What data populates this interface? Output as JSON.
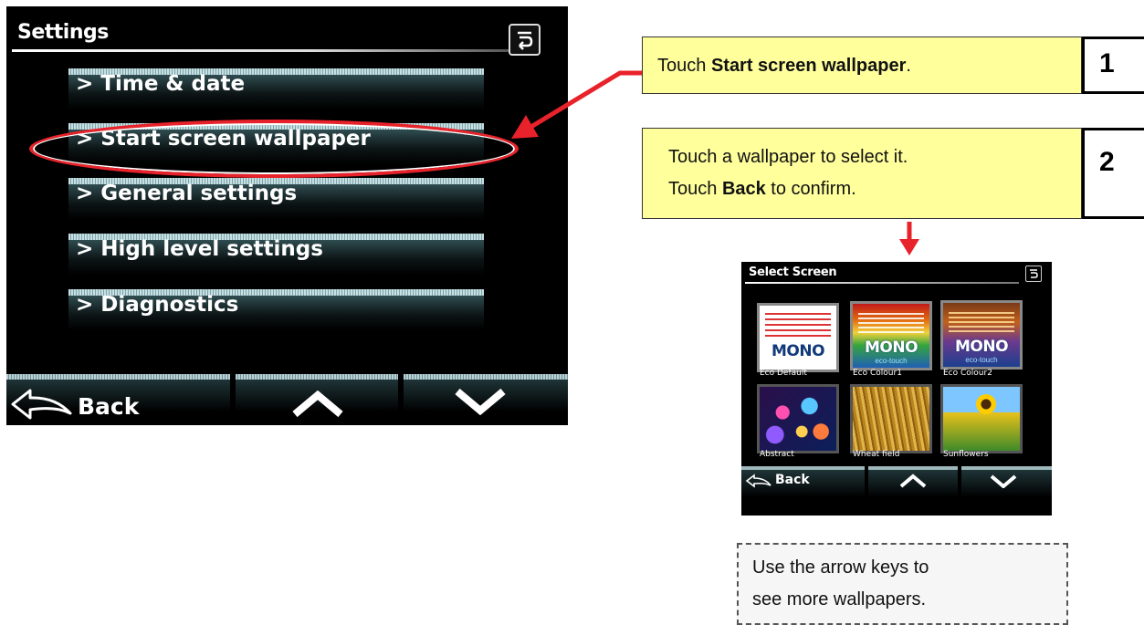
{
  "device": {
    "title": "Settings",
    "menu": [
      {
        "label": "> Time & date"
      },
      {
        "label": "> Start screen wallpaper"
      },
      {
        "label": "> General settings"
      },
      {
        "label": "> High level settings"
      },
      {
        "label": "> Diagnostics"
      }
    ],
    "softkeys": {
      "back_label": "Back"
    }
  },
  "steps": [
    {
      "number": "1",
      "text_pre": "Touch ",
      "text_bold": "Start screen wallpaper",
      "text_post": "."
    },
    {
      "number": "2",
      "line1": "Touch a wallpaper to select it.",
      "line2_pre": "Touch ",
      "line2_bold": "Back",
      "line2_post": " to confirm."
    }
  ],
  "select_screen": {
    "title": "Select Screen",
    "wallpapers": [
      {
        "name": "Eco Default",
        "logo": "MONO"
      },
      {
        "name": "Eco Colour1",
        "logo": "MONO",
        "sub": "eco-touch"
      },
      {
        "name": "Eco Colour2",
        "logo": "MONO",
        "sub": "eco-touch"
      },
      {
        "name": "Abstract"
      },
      {
        "name": "Wheat field"
      },
      {
        "name": "Sunflowers"
      }
    ],
    "back_label": "Back"
  },
  "note": {
    "line1": "Use the arrow keys to",
    "line2": "see more wallpapers."
  },
  "colors": {
    "callout_bg": "#ffff9c",
    "highlight": "#e8222a",
    "arrow": "#e8222a"
  }
}
